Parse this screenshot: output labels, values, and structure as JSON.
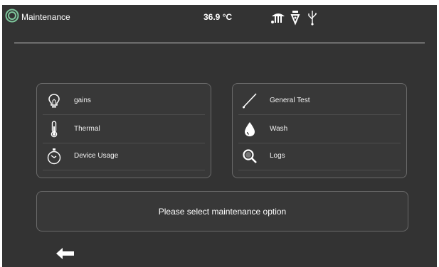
{
  "header": {
    "title": "Maintenance",
    "temperature": "36.9 °C",
    "status_icons": [
      "spray-nozzle-icon",
      "pen-nib-icon",
      "usb-icon"
    ]
  },
  "left_panel": {
    "items": [
      {
        "label": "gains",
        "icon": "lightbulb-icon"
      },
      {
        "label": "Thermal",
        "icon": "thermometer-icon"
      },
      {
        "label": "Device Usage",
        "icon": "stopwatch-icon"
      }
    ]
  },
  "right_panel": {
    "items": [
      {
        "label": "General Test",
        "icon": "wand-icon"
      },
      {
        "label": "Wash",
        "icon": "droplet-icon"
      },
      {
        "label": "Logs",
        "icon": "magnifier-icon"
      }
    ]
  },
  "message": "Please select maintenance option",
  "colors": {
    "background": "#333333",
    "panel_border": "#6a6a6a",
    "text": "#ffffff",
    "logo": "#7cc49a"
  }
}
